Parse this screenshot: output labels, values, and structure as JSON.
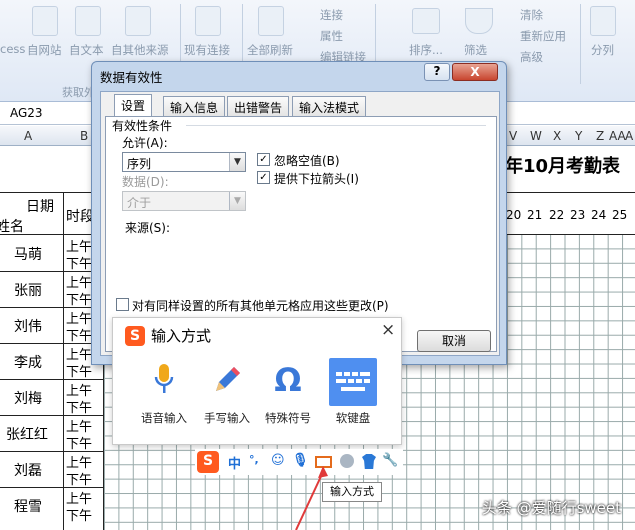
{
  "ribbon": {
    "items": [
      {
        "label": "cess"
      },
      {
        "label": "自网站"
      },
      {
        "label": "自文本"
      },
      {
        "label": "自其他来源"
      },
      {
        "label": "现有连接"
      },
      {
        "label": "全部刷新"
      },
      {
        "label": "排序..."
      },
      {
        "label": "筛选"
      },
      {
        "label": "分列"
      }
    ],
    "small": [
      "连接",
      "属性",
      "编辑链接",
      "清除",
      "重新应用",
      "高级"
    ],
    "group_label": "获取外"
  },
  "formula_bar": {
    "name_box": "AG23"
  },
  "columns": {
    "left": [
      "A",
      "B"
    ],
    "right": [
      "V",
      "W",
      "X",
      "Y",
      "Z",
      "AA",
      "A"
    ]
  },
  "sheet": {
    "title_partial": "年10月考勤表",
    "header_date": "日期",
    "header_name": "姓名",
    "header_period": "时段",
    "day_numbers": [
      "20",
      "21",
      "22",
      "23",
      "24",
      "25"
    ],
    "employees": [
      "马萌",
      "张丽",
      "刘伟",
      "李成",
      "刘梅",
      "张红红",
      "刘磊",
      "程雪"
    ],
    "am": "上午",
    "pm": "下午"
  },
  "dialog": {
    "title": "数据有效性",
    "help": "?",
    "close": "X",
    "tabs": [
      "设置",
      "输入信息",
      "出错警告",
      "输入法模式"
    ],
    "criteria_label": "有效性条件",
    "allow_label": "允许(A):",
    "allow_value": "序列",
    "ignore_blank": "忽略空值(B)",
    "dropdown": "提供下拉箭头(I)",
    "data_label": "数据(D):",
    "data_value": "介于",
    "source_label": "来源(S):",
    "source_value": "√,▲,□,★,○|",
    "apply_all": "对有同样设置的所有其他单元格应用这些更改(P)",
    "cancel": "取消"
  },
  "ime": {
    "logo": "S",
    "title": "输入方式",
    "close": "×",
    "options": [
      "语音输入",
      "手写输入",
      "特殊符号",
      "软键盘"
    ],
    "toolbar": {
      "lang": "中",
      "punct": "°,",
      "tooltip": "输入方式"
    }
  },
  "watermark": "头条 @爱随行sweet"
}
